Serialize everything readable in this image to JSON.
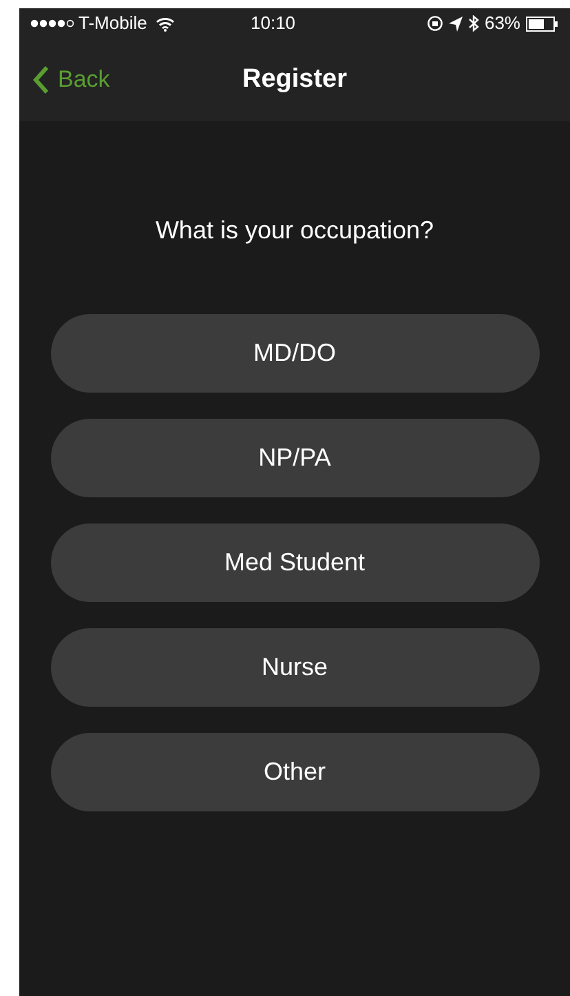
{
  "status_bar": {
    "carrier": "T-Mobile",
    "time": "10:10",
    "battery": "63%"
  },
  "nav_bar": {
    "back": "Back",
    "title": "Register"
  },
  "question": "What is your occupation?",
  "options": [
    {
      "label": "MD/DO"
    },
    {
      "label": "NP/PA"
    },
    {
      "label": "Med Student"
    },
    {
      "label": "Nurse"
    },
    {
      "label": "Other"
    }
  ]
}
